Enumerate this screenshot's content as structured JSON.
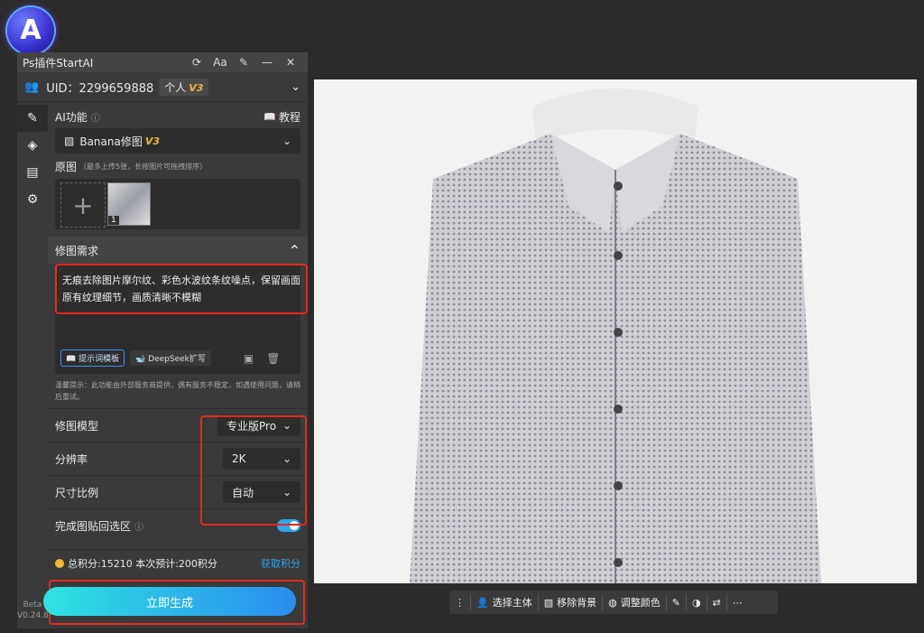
{
  "app": {
    "title": "Ps插件StartAI",
    "logo_letter": "A"
  },
  "titlebar": {
    "refresh": "⟳",
    "font": "Aa",
    "pin": "✎",
    "minimize": "—",
    "close": "✕"
  },
  "user": {
    "uid": "UID：2299659888",
    "type": "个人",
    "level": "V3"
  },
  "beta": {
    "label": "Beta",
    "version": "V0.24.8"
  },
  "ai": {
    "label": "AI功能",
    "tutorial": "教程",
    "selected": "Banana修图",
    "level": "V3"
  },
  "source": {
    "label": "原图",
    "hint": "（最多上传5张，长按图片可拖拽排序）",
    "count": "1"
  },
  "request": {
    "label": "修图需求",
    "text": "无痕去除图片摩尔纹、彩色水波纹条纹噪点，保留画面原有纹理细节，画质清晰不模糊",
    "template_btn": "提示词模板",
    "deepseek_btn": "DeepSeek扩写"
  },
  "tip": "温馨提示：此功能由外部服务商提供，偶有服务不稳定，如遇使用问题，请稍后重试。",
  "options": [
    {
      "label": "修图模型",
      "value": "专业版Pro"
    },
    {
      "label": "分辨率",
      "value": "2K"
    },
    {
      "label": "尺寸比例",
      "value": "自动"
    }
  ],
  "paste": {
    "label": "完成图贴回选区"
  },
  "points": {
    "text": "总积分:15210  本次预计:200积分",
    "link": "获取积分"
  },
  "generate": "立即生成",
  "bottombar": {
    "select": "选择主体",
    "remove_bg": "移除背景",
    "adjust": "调整颜色"
  }
}
